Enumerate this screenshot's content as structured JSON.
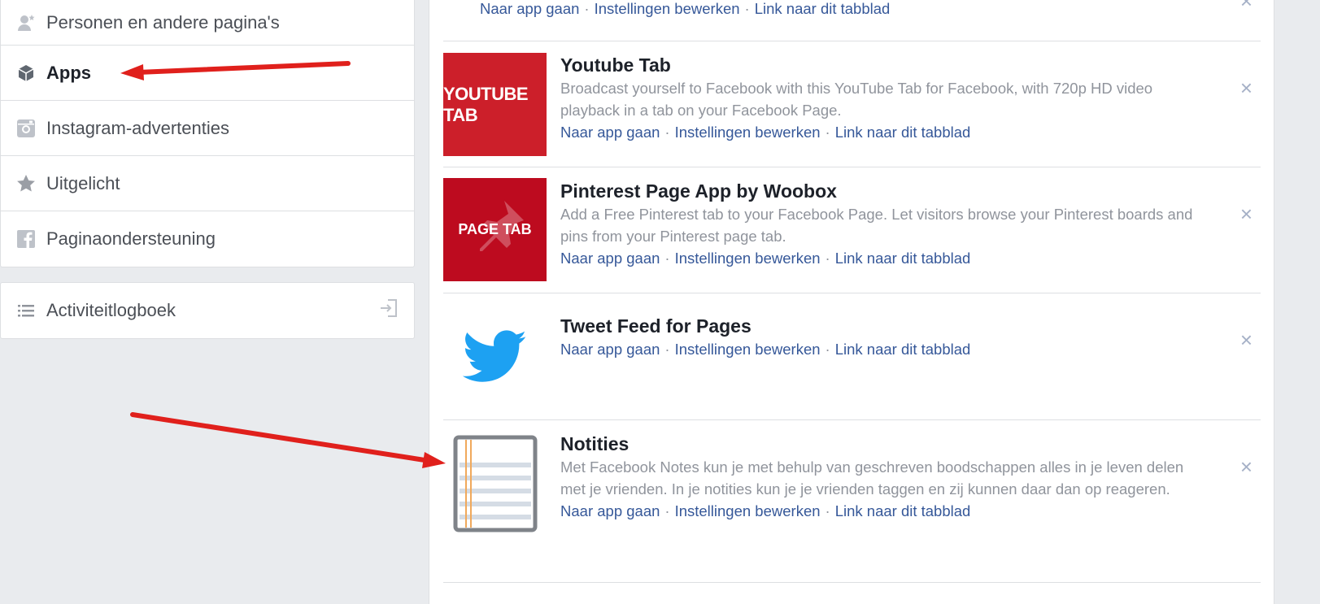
{
  "sidebar": {
    "items": [
      {
        "label": "Personen en andere pagina's",
        "icon": "people-icon"
      },
      {
        "label": "Apps",
        "icon": "cube-icon"
      },
      {
        "label": "Instagram-advertenties",
        "icon": "instagram-icon"
      },
      {
        "label": "Uitgelicht",
        "icon": "star-icon"
      },
      {
        "label": "Paginaondersteuning",
        "icon": "facebook-icon"
      }
    ],
    "activity": {
      "label": "Activiteitlogboek",
      "icon": "list-icon"
    }
  },
  "top_links": {
    "go": "Naar app gaan",
    "settings": "Instellingen bewerken",
    "link": "Link naar dit tabblad"
  },
  "apps": [
    {
      "title": "Youtube Tab",
      "thumb_text": "YOUTUBE TAB",
      "desc": "Broadcast yourself to Facebook with this YouTube Tab for Facebook, with 720p HD video playback in a tab on your Facebook Page.",
      "go": "Naar app gaan",
      "settings": "Instellingen bewerken",
      "link": "Link naar dit tabblad"
    },
    {
      "title": "Pinterest Page App by Woobox",
      "thumb_text": "PAGE TAB",
      "desc": "Add a Free Pinterest tab to your Facebook Page. Let visitors browse your Pinterest boards and pins from your Pinterest page tab.",
      "go": "Naar app gaan",
      "settings": "Instellingen bewerken",
      "link": "Link naar dit tabblad"
    },
    {
      "title": "Tweet Feed for Pages",
      "go": "Naar app gaan",
      "settings": "Instellingen bewerken",
      "link": "Link naar dit tabblad"
    },
    {
      "title": "Notities",
      "desc": "Met Facebook Notes kun je met behulp van geschreven boodschappen alles in je leven delen met je vrienden. In je notities kun je je vrienden taggen en zij kunnen daar dan op reageren.",
      "go": "Naar app gaan",
      "settings": "Instellingen bewerken",
      "link": "Link naar dit tabblad"
    }
  ],
  "colors": {
    "link": "#365899",
    "arrow": "#e0201c",
    "twitter": "#1da1f2"
  }
}
